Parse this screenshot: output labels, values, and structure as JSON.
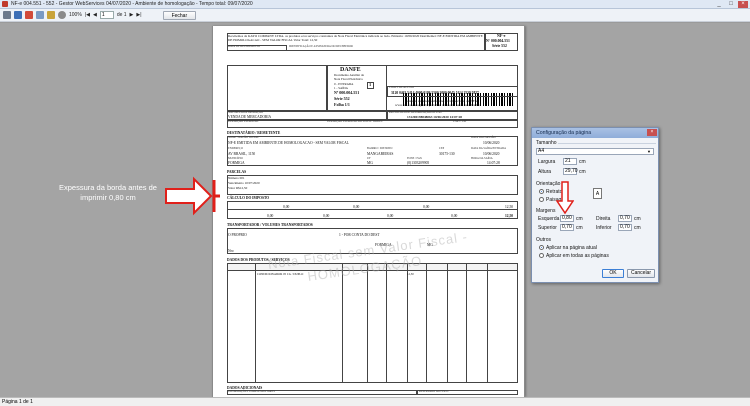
{
  "window": {
    "title": "NF-e 004.551 - 552 - Gestor WebServices 04/07/2020 - Ambiente de homologação - Tempo total: 09/07/2020"
  },
  "toolbar": {
    "zoom": "100%",
    "page_number": "1",
    "page_total": "de 1",
    "close_label": "Fechar"
  },
  "status": {
    "page": "Página 1 de 1"
  },
  "annotation": {
    "text": "Expessura da borda antes de imprimir 0,80 cm"
  },
  "danfe": {
    "receipt": "Recebemos da KAYO COMPANY LTDA. os produtos e/ou serviços constantes da Nota Fiscal Eletrônica indicada ao lado. Emissão: 10/06/2020 Dest/Remet: NF-E EMITIDA EM AMBIENTE DE HOMOLOGACAO - SEM VALOR FISCAL Valor Total: 12,50",
    "receipt_date_label": "DATA DE RECEBIMENTO",
    "receipt_sign_label": "IDENTIFICAÇÃO E ASSINATURA DO RECEBEDOR",
    "nfe_small": "NF-e",
    "nfe_number_small": "Nº 000.004.551",
    "serie_small": "Série 552",
    "title": "DANFE",
    "subtitle1": "Documento Auxiliar da",
    "subtitle2": "Nota Fiscal Eletrônica",
    "entry": "0 - ENTRADA",
    "exit": "1 - SAÍDA",
    "type": "1",
    "number": "Nº 000.004.551",
    "serie": "Série 552",
    "sheet": "Folha 1/1",
    "access_key_label": "CHAVE DE ACESSO",
    "access_key": "3120 0463 5414 4000 0186 5500 2000 0045 5114 2539 5827",
    "consult1": "Consulta de autenticidade no portal nacional da NF-e",
    "consult2": "www.nfe.fazenda.gov.br/portal ou no site da Sefaz autorizadora",
    "nature_label": "NATUREZA DA OPERAÇÃO",
    "nature": "VENDA DE MERCADORIA",
    "protocol_label": "PROTOCOLO DE AUTORIZAÇÃO DE USO",
    "protocol": "131200198848063 10/06/2020 14:07:28",
    "ie_label": "INSCRIÇÃO ESTADUAL",
    "ie_st_label": "INSCRIÇÃO ESTADUAL DO SUBST. TRIBUT.",
    "cnpj_label": "CNPJ / CPF",
    "dest_title": "DESTINATÁRIO / REMETENTE",
    "dest_name_label": "NOME / RAZÃO SOCIAL",
    "dest_name": "NF-E EMITIDA EM AMBIENTE DE HOMOLOGACAO - SEM VALOR FISCAL",
    "dest_date_label": "DATA DA EMISSÃO",
    "dest_date": "10/06/2020",
    "dest_addr_label": "ENDEREÇO",
    "dest_addr": "AV BRASIL, 1150",
    "dest_district_label": "BAIRRO / DISTRITO",
    "dest_district": "MANGABEIRAS",
    "dest_cep_label": "CEP",
    "dest_cep": "30175-130",
    "dest_exit_label": "DATA DA SAÍDA/ENTRADA",
    "dest_exit": "10/06/2020",
    "dest_city_label": "MUNICÍPIO",
    "dest_city": "FORMIGA",
    "dest_uf_label": "UF",
    "dest_uf": "MG",
    "dest_phone_label": "FONE / FAX",
    "dest_phone": "(0)1303209905",
    "dest_hour_label": "HORA DA SAÍDA",
    "dest_hour": "14:07:28",
    "parcels_title": "PARCELAS",
    "parcel_lines": [
      "Número 001",
      "Vencimento 10/07/2020",
      "Valor R$12,50"
    ],
    "tax_title": "CÁLCULO DO IMPOSTO",
    "tax_value_a": "0,00",
    "tax_value_b": "0,00",
    "tax_value_c": "0,00",
    "tax_total_products": "12,50",
    "tax_value_d": "0,00",
    "tax_value_e": "0,00",
    "tax_value_f": "0,00",
    "tax_value_g": "0,00",
    "tax_total_note": "12,50",
    "transport_title": "TRANSPORTADOR / VOLUMES TRANSPORTADOS",
    "transport_name": "O PROPRIO",
    "transport_freight": "1 - POR CONTA DO DEST",
    "transport_city": "FORMIGA",
    "transport_uf": "MG",
    "transport_qty": "Nro",
    "products_title": "DADOS DOS PRODUTOS / SERVIÇOS",
    "product_row": "CONDICIONADOR 05 CG / DUPLO",
    "product_total": "12,50",
    "extra_title": "DADOS ADICIONAIS",
    "extra_label": "INFORMAÇÕES COMPLEMENTARES",
    "extra_label2": "RESERVADO AO FISCO",
    "watermark1": "Nota Fiscal sem Valor Fiscal -",
    "watermark2": "HOMOLOGAÇÃO"
  },
  "dialog": {
    "title": "Configuração da página",
    "size_group": "Tamanho",
    "paper": "A4",
    "width_label": "Largura",
    "width_value": "21",
    "height_label": "Altura",
    "height_value": "29,70",
    "unit": "cm",
    "orientation_group": "Orientação",
    "portrait": "Retrato",
    "landscape": "Paisagem",
    "margins_group": "Margens",
    "left_label": "Esquerda",
    "left_value": "0,80",
    "right_label": "Direita",
    "right_value": "0,70",
    "top_label": "Superior",
    "top_value": "0,70",
    "bottom_label": "Inferior",
    "bottom_value": "0,70",
    "others_group": "Outros",
    "apply_current": "Aplicar na página atual",
    "apply_all": "Aplicar em todas as páginas",
    "ok": "OK",
    "cancel": "Cancelar"
  },
  "colors": {
    "annotation_red": "#e0201a",
    "dialog_title": "#8fadd9"
  },
  "icons": [
    "print-icon",
    "save-icon",
    "export-icon",
    "page-setup-icon",
    "zoom-icon",
    "first-page-icon",
    "prev-page-icon",
    "next-page-icon",
    "last-page-icon"
  ]
}
